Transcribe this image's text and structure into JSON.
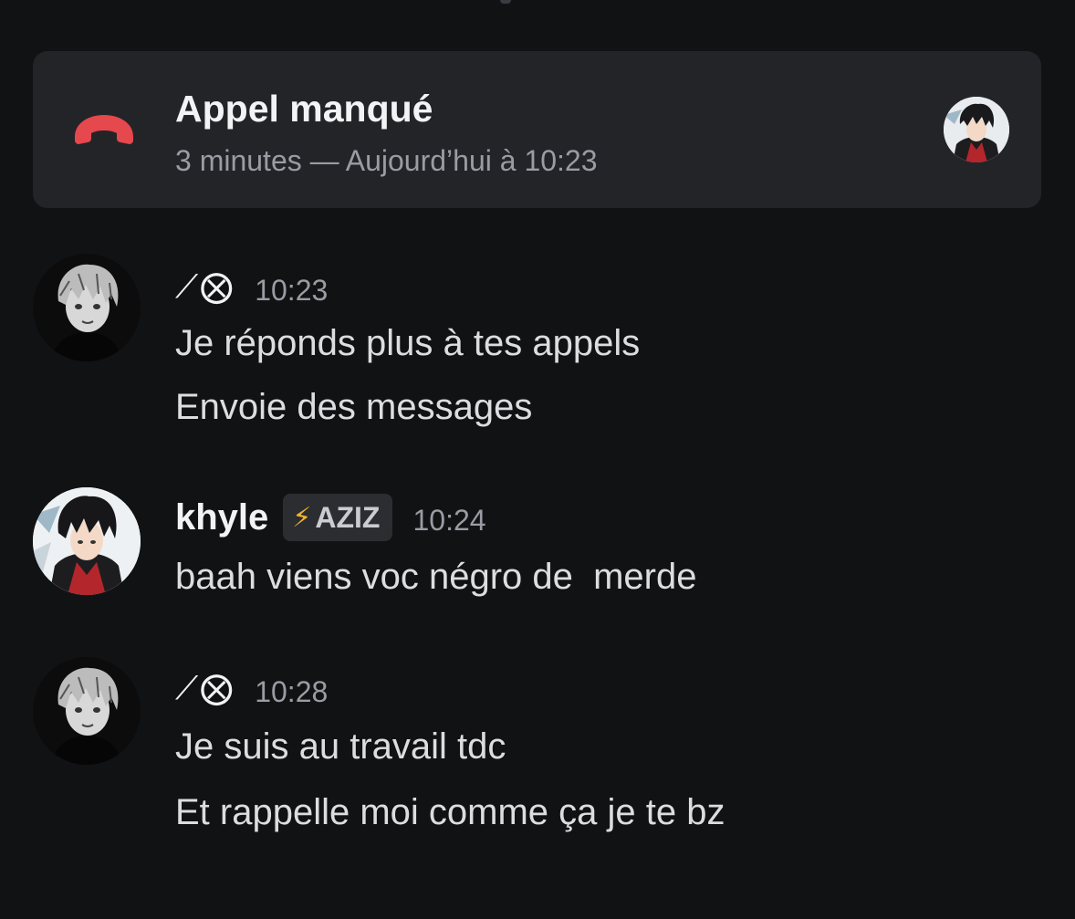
{
  "missed_call": {
    "title": "Appel manqué",
    "subtitle": "3 minutes — Aujourd’hui à 10:23",
    "icon": "phone-hangup-icon",
    "icon_color": "#e5484d"
  },
  "messages": [
    {
      "author": "⟋⨂",
      "timestamp": "10:23",
      "lines": [
        "Je réponds plus à tes appels",
        "Envoie des messages"
      ]
    },
    {
      "author": "khyle",
      "tag": {
        "icon": "⚡",
        "label": "AZIZ"
      },
      "timestamp": "10:24",
      "lines": [
        "baah viens voc négro de  merde"
      ]
    },
    {
      "author": "⟋⨂",
      "timestamp": "10:28",
      "lines": [
        "Je suis au travail tdc",
        "Et rappelle moi comme ça je te bz"
      ]
    }
  ],
  "colors": {
    "background": "#111214",
    "card": "#232428",
    "tag_bg": "#2b2d31",
    "text_primary": "#f2f3f5",
    "text_muted": "#9a9ca3",
    "lightning": "#f0b232"
  }
}
